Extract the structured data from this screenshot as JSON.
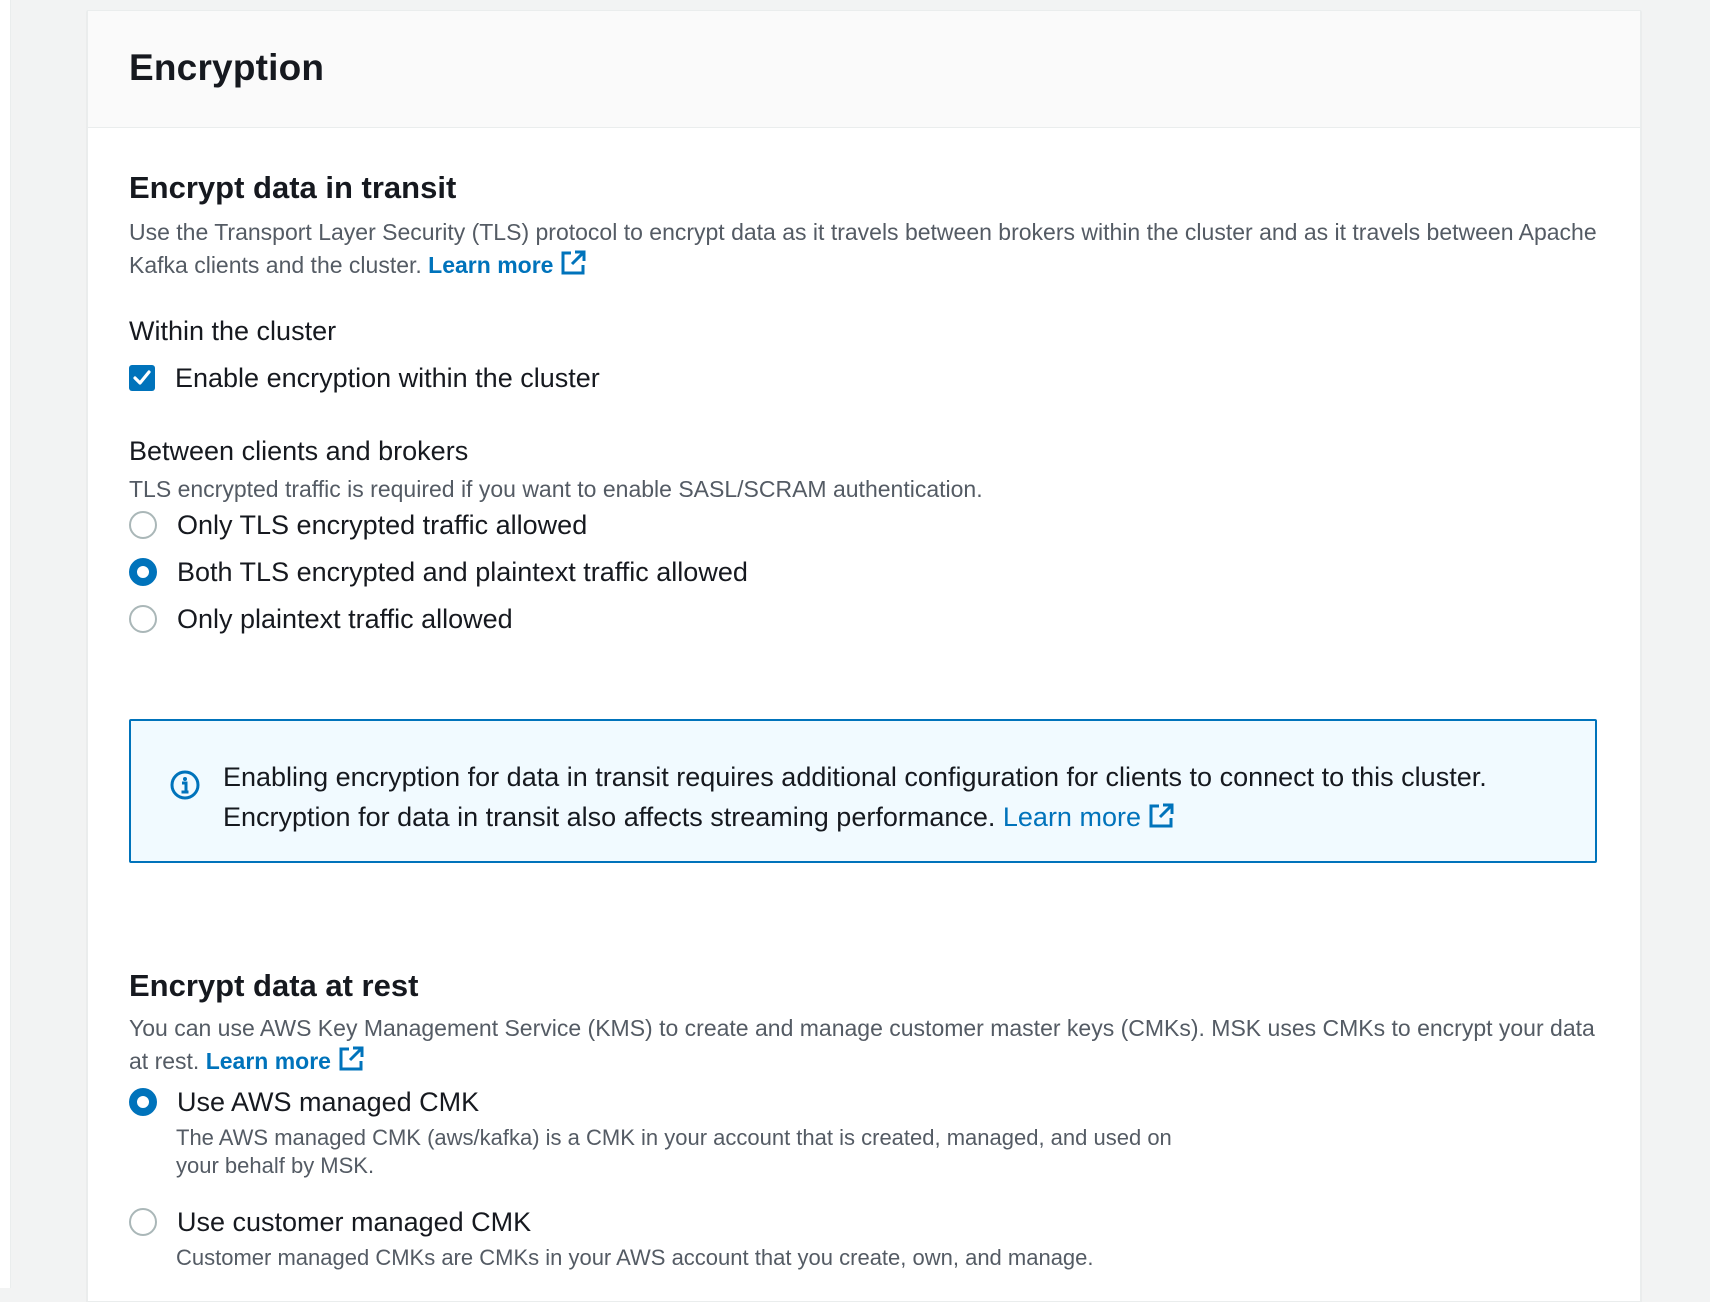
{
  "panel": {
    "title": "Encryption"
  },
  "transit": {
    "heading": "Encrypt data in transit",
    "description": "Use the Transport Layer Security (TLS) protocol to encrypt data as it travels between brokers within the cluster and as it travels between Apache Kafka clients and the cluster.",
    "learn_more": "Learn more",
    "within_cluster": {
      "label": "Within the cluster",
      "checkbox_label": "Enable encryption within the cluster",
      "checked": true
    },
    "between_clients": {
      "label": "Between clients and brokers",
      "hint": "TLS encrypted traffic is required if you want to enable SASL/SCRAM authentication.",
      "options": [
        {
          "label": "Only TLS encrypted traffic allowed",
          "selected": false
        },
        {
          "label": "Both TLS encrypted and plaintext traffic allowed",
          "selected": true
        },
        {
          "label": "Only plaintext traffic allowed",
          "selected": false
        }
      ]
    },
    "alert": {
      "icon": "info-icon",
      "text": "Enabling encryption for data in transit requires additional configuration for clients to connect to this cluster. Encryption for data in transit also affects streaming performance.",
      "learn_more": "Learn more"
    }
  },
  "at_rest": {
    "heading": "Encrypt data at rest",
    "description": "You can use AWS Key Management Service (KMS) to create and manage customer master keys (CMKs). MSK uses CMKs to encrypt your data at rest.",
    "learn_more": "Learn more",
    "options": [
      {
        "label": "Use AWS managed CMK",
        "description": "The AWS managed CMK (aws/kafka) is a CMK in your account that is created, managed, and used on your behalf by MSK.",
        "selected": true
      },
      {
        "label": "Use customer managed CMK",
        "description": "Customer managed CMKs are CMKs in your AWS account that you create, own, and manage.",
        "selected": false
      }
    ]
  },
  "colors": {
    "accent": "#0073bb",
    "text": "#16191f",
    "muted": "#545b64",
    "alert_bg": "#f1faff",
    "header_bg": "#fafafa"
  }
}
